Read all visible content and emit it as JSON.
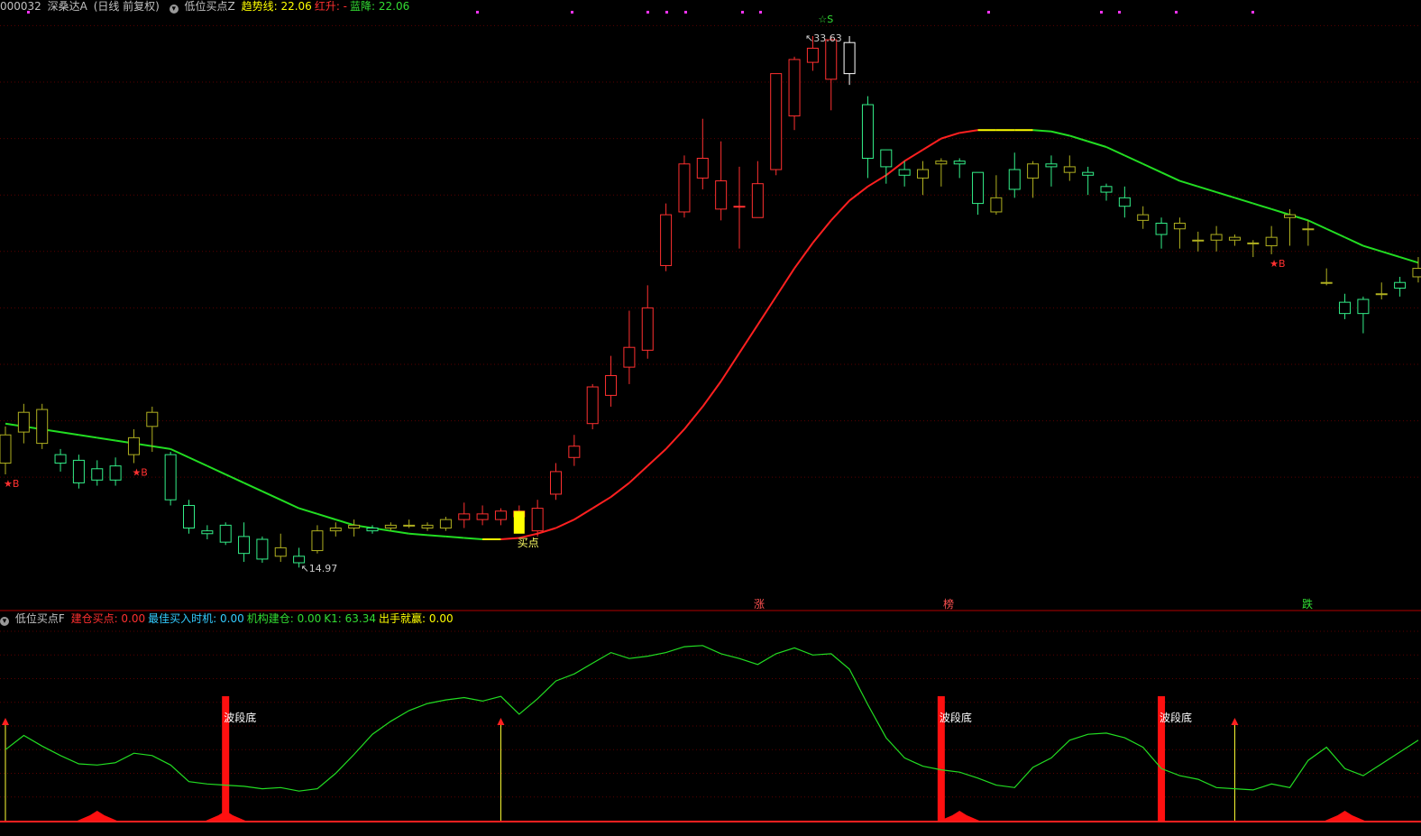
{
  "header_main": {
    "code": "000032",
    "name": "深桑达A",
    "period": "(日线 前复权)",
    "indicator": "低位买点Z",
    "fields": [
      {
        "label": "趋势线:",
        "value": "22.06",
        "color": "#ffff00"
      },
      {
        "label": "红升:",
        "value": "-",
        "color": "#ff3030"
      },
      {
        "label": "蓝降:",
        "value": "22.06",
        "color": "#33dd33"
      }
    ]
  },
  "header_sub": {
    "indicator": "低位买点F",
    "fields": [
      {
        "label": "建仓买点:",
        "value": "0.00",
        "color": "#ff3030"
      },
      {
        "label": "最佳买入时机:",
        "value": "0.00",
        "color": "#33ccff"
      },
      {
        "label": "机构建仓:",
        "value": "0.00",
        "color": "#33dd33"
      },
      {
        "label": "K1:",
        "value": "63.34",
        "color": "#33dd33"
      },
      {
        "label": "出手就赢:",
        "value": "0.00",
        "color": "#ffff00"
      }
    ]
  },
  "chart_data": [
    {
      "type": "candlestick",
      "annotations": {
        "high_label": "33.63",
        "low_label": "14.97",
        "buy_label": "买点",
        "buy_mark": "★B",
        "sell_mark": "☆S",
        "event_labels": [
          "涨",
          "榜",
          "跌"
        ]
      },
      "candles": [
        [
          18.5,
          19.5,
          19.8,
          18.1
        ],
        [
          19.6,
          20.3,
          20.6,
          19.2
        ],
        [
          19.2,
          20.4,
          20.6,
          19.0
        ],
        [
          18.8,
          18.5,
          19.0,
          18.2
        ],
        [
          18.6,
          17.8,
          18.8,
          17.6
        ],
        [
          18.3,
          17.9,
          18.6,
          17.7
        ],
        [
          18.4,
          17.9,
          18.7,
          17.7
        ],
        [
          18.8,
          19.4,
          19.7,
          18.5
        ],
        [
          19.8,
          20.3,
          20.5,
          18.9
        ],
        [
          18.8,
          17.2,
          18.9,
          17.0
        ],
        [
          17.0,
          16.2,
          17.2,
          16.0
        ],
        [
          16.1,
          16.0,
          16.3,
          15.8
        ],
        [
          16.3,
          15.7,
          16.4,
          15.6
        ],
        [
          15.9,
          15.3,
          16.4,
          15.0
        ],
        [
          15.8,
          15.1,
          15.9,
          14.97
        ],
        [
          15.2,
          15.5,
          16.0,
          15.0
        ],
        [
          15.2,
          14.97,
          15.5,
          14.8
        ],
        [
          15.4,
          16.1,
          16.3,
          15.3
        ],
        [
          16.1,
          16.2,
          16.4,
          15.9
        ],
        [
          16.2,
          16.3,
          16.5,
          15.9
        ],
        [
          16.2,
          16.1,
          16.3,
          16.0
        ],
        [
          16.2,
          16.3,
          16.4,
          16.1
        ],
        [
          16.3,
          16.3,
          16.5,
          16.2
        ],
        [
          16.2,
          16.3,
          16.4,
          16.1
        ],
        [
          16.2,
          16.5,
          16.6,
          16.1
        ],
        [
          16.5,
          16.7,
          17.1,
          16.2
        ],
        [
          16.5,
          16.7,
          17.0,
          16.3
        ],
        [
          16.5,
          16.8,
          16.9,
          16.3
        ],
        [
          16.6,
          16.8,
          17.0,
          16.4
        ],
        [
          16.1,
          16.9,
          17.2,
          15.9
        ],
        [
          17.4,
          18.2,
          18.5,
          17.2
        ],
        [
          18.7,
          19.1,
          19.5,
          18.4
        ],
        [
          19.9,
          21.2,
          21.3,
          19.7
        ],
        [
          20.9,
          21.6,
          22.3,
          20.5
        ],
        [
          21.9,
          22.6,
          23.9,
          21.3
        ],
        [
          22.5,
          24.0,
          24.8,
          22.2
        ],
        [
          25.5,
          27.3,
          27.7,
          25.3
        ],
        [
          27.4,
          29.1,
          29.4,
          27.2
        ],
        [
          28.6,
          29.3,
          30.7,
          28.2
        ],
        [
          27.5,
          28.5,
          29.9,
          27.1
        ],
        [
          27.6,
          27.6,
          29.0,
          26.1
        ],
        [
          27.2,
          28.4,
          29.2,
          27.2
        ],
        [
          28.9,
          32.3,
          32.3,
          28.7
        ],
        [
          30.8,
          32.8,
          32.9,
          30.3
        ],
        [
          32.7,
          33.2,
          33.63,
          32.4
        ],
        [
          32.1,
          33.5,
          33.63,
          31.0
        ],
        [
          33.4,
          32.3,
          33.63,
          31.9
        ],
        [
          31.2,
          29.3,
          31.5,
          28.6
        ],
        [
          29.6,
          29.0,
          29.6,
          28.4
        ],
        [
          28.9,
          28.7,
          29.2,
          28.3
        ],
        [
          28.6,
          28.9,
          29.2,
          28.0
        ],
        [
          29.1,
          29.2,
          29.3,
          28.3
        ],
        [
          29.2,
          29.1,
          29.3,
          28.6
        ],
        [
          28.8,
          27.7,
          28.8,
          27.3
        ],
        [
          27.4,
          27.9,
          28.7,
          27.3
        ],
        [
          28.9,
          28.2,
          29.5,
          27.9
        ],
        [
          28.6,
          29.1,
          29.2,
          27.9
        ],
        [
          29.1,
          29.0,
          29.4,
          28.3
        ],
        [
          28.8,
          29.0,
          29.4,
          28.5
        ],
        [
          28.8,
          28.7,
          29.0,
          28.0
        ],
        [
          28.3,
          28.1,
          28.4,
          27.8
        ],
        [
          27.9,
          27.6,
          28.3,
          27.2
        ],
        [
          27.1,
          27.3,
          27.6,
          26.8
        ],
        [
          27.0,
          26.6,
          27.2,
          26.1
        ],
        [
          26.8,
          27.0,
          27.2,
          26.1
        ],
        [
          26.4,
          26.4,
          26.7,
          26.0
        ],
        [
          26.4,
          26.6,
          26.9,
          26.0
        ],
        [
          26.4,
          26.5,
          26.6,
          26.2
        ],
        [
          26.3,
          26.3,
          26.4,
          25.8
        ],
        [
          26.2,
          26.5,
          26.9,
          25.9
        ],
        [
          27.2,
          27.3,
          27.5,
          26.2
        ],
        [
          26.8,
          26.8,
          27.1,
          26.2
        ],
        [
          24.9,
          24.9,
          25.4,
          24.8
        ],
        [
          24.2,
          23.8,
          24.5,
          23.6
        ],
        [
          24.3,
          23.8,
          24.4,
          23.1
        ],
        [
          24.5,
          24.5,
          24.9,
          24.3
        ],
        [
          24.9,
          24.7,
          25.1,
          24.4
        ],
        [
          25.1,
          25.4,
          25.8,
          24.9
        ]
      ],
      "trend_line": [
        19.9,
        19.8,
        19.7,
        19.6,
        19.5,
        19.4,
        19.3,
        19.2,
        19.1,
        19.0,
        18.7,
        18.4,
        18.1,
        17.8,
        17.5,
        17.2,
        16.9,
        16.7,
        16.5,
        16.3,
        16.2,
        16.1,
        16.0,
        15.95,
        15.9,
        15.85,
        15.8,
        15.8,
        15.85,
        16.0,
        16.2,
        16.5,
        16.9,
        17.3,
        17.8,
        18.4,
        19.0,
        19.7,
        20.5,
        21.4,
        22.4,
        23.4,
        24.4,
        25.4,
        26.3,
        27.1,
        27.8,
        28.3,
        28.7,
        29.2,
        29.6,
        30.0,
        30.2,
        30.3,
        30.3,
        30.3,
        30.3,
        30.25,
        30.1,
        29.9,
        29.7,
        29.4,
        29.1,
        28.8,
        28.5,
        28.3,
        28.1,
        27.9,
        27.7,
        27.5,
        27.3,
        27.1,
        26.8,
        26.5,
        26.2,
        26.0,
        25.8,
        25.6
      ],
      "price_grid": [
        18,
        20,
        22,
        24,
        26,
        28,
        30,
        32,
        34
      ]
    },
    {
      "type": "line",
      "series": [
        {
          "name": "K1",
          "values": [
            60,
            72,
            63,
            55,
            48,
            47,
            49,
            57,
            55,
            47,
            33,
            31,
            30,
            29,
            27,
            28,
            25,
            27,
            40,
            56,
            73,
            84,
            93,
            99,
            102,
            104,
            101,
            105,
            90,
            103,
            118,
            124,
            133,
            142,
            137,
            139,
            142,
            147,
            148,
            141,
            137,
            132,
            141,
            146,
            140,
            141,
            128,
            98,
            70,
            53,
            46,
            43,
            41,
            36,
            30,
            28,
            45,
            53,
            68,
            73,
            74,
            70,
            62,
            44,
            38,
            35,
            28,
            27,
            26,
            31,
            28,
            51,
            62,
            44,
            38,
            48,
            58,
            68
          ]
        }
      ],
      "bands": [
        {
          "label": "波段底",
          "index": 12
        },
        {
          "label": "波段底",
          "index": 51
        },
        {
          "label": "波段底",
          "index": 63
        }
      ],
      "arrows": [
        0,
        27,
        67
      ],
      "y_max": 160,
      "grid": [
        20,
        40,
        60,
        80,
        100,
        120,
        140,
        160
      ]
    }
  ]
}
